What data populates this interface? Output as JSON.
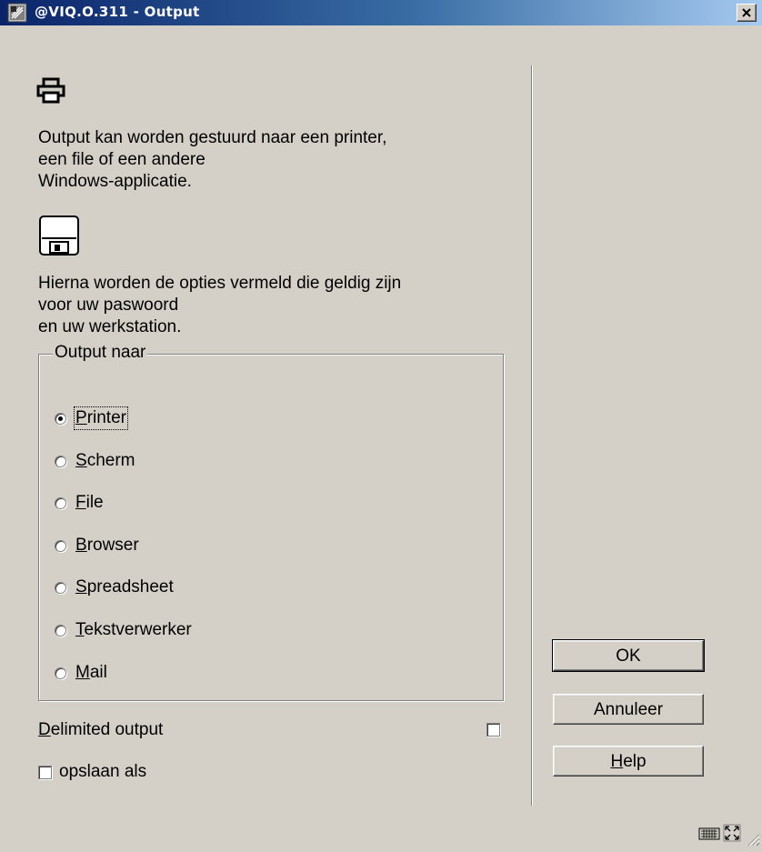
{
  "window": {
    "title": "@VIQ.O.311 - Output"
  },
  "intro": {
    "printer_text_lines": [
      "Output kan worden gestuurd naar een printer,",
      "een file of een andere",
      "Windows-applicatie."
    ],
    "options_text_lines": [
      "Hierna worden de opties vermeld die geldig zijn",
      "voor uw paswoord",
      "en uw werkstation."
    ]
  },
  "output_group": {
    "legend": "Output naar",
    "options": [
      {
        "mnemonic": "P",
        "rest": "rinter",
        "checked": true
      },
      {
        "mnemonic": "S",
        "rest": "cherm",
        "checked": false
      },
      {
        "mnemonic": "F",
        "rest": "ile",
        "checked": false
      },
      {
        "mnemonic": "B",
        "rest": "rowser",
        "checked": false
      },
      {
        "mnemonic": "S",
        "rest": "preadsheet",
        "checked": false
      },
      {
        "mnemonic": "T",
        "rest": "ekstverwerker",
        "checked": false
      },
      {
        "mnemonic": "M",
        "rest": "ail",
        "checked": false
      }
    ]
  },
  "delimited": {
    "mnemonic": "D",
    "rest": "elimited output",
    "checked": false
  },
  "save_as": {
    "label": "opslaan als",
    "checked": false
  },
  "buttons": {
    "ok": "OK",
    "cancel": "Annuleer",
    "help_mnemonic": "H",
    "help_rest": "elp"
  },
  "icons": {
    "app": "app-icon",
    "printer": "printer-icon",
    "floppy": "floppy-disk-icon",
    "close": "close-icon",
    "keyboard": "keyboard-icon",
    "maximize": "maximize-icon",
    "resize": "resize-grip-icon"
  }
}
